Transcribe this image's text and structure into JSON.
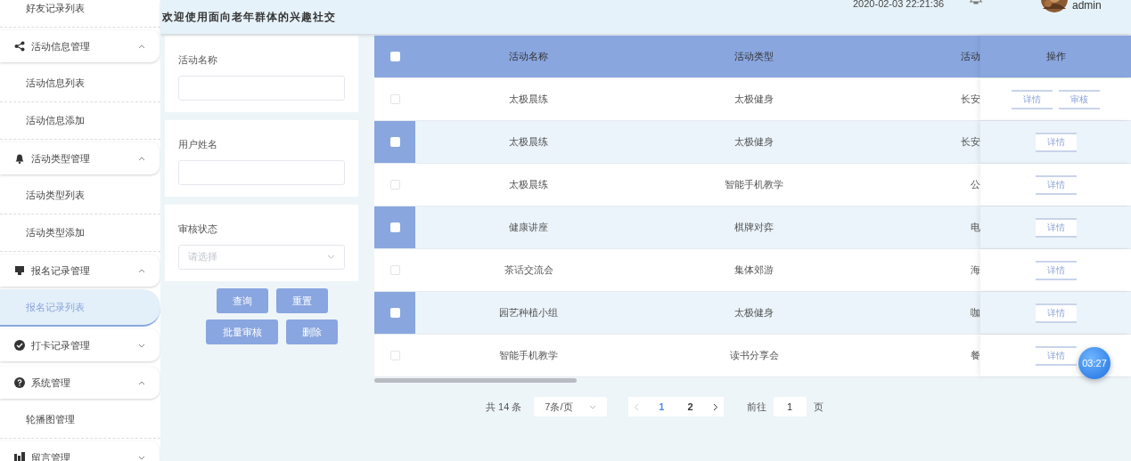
{
  "header": {
    "title": "欢迎使用面向老年群体的兴趣社交",
    "datetime": "2020-02-03 22:21:36",
    "user": "admin"
  },
  "sidebar": {
    "items": [
      {
        "kind": "sub",
        "label": "好友记录列表",
        "selected": false
      },
      {
        "kind": "group",
        "label": "活动信息管理",
        "expanded": true
      },
      {
        "kind": "sub",
        "label": "活动信息列表",
        "selected": false
      },
      {
        "kind": "sub",
        "label": "活动信息添加",
        "selected": false
      },
      {
        "kind": "group",
        "label": "活动类型管理",
        "expanded": true
      },
      {
        "kind": "sub",
        "label": "活动类型列表",
        "selected": false
      },
      {
        "kind": "sub",
        "label": "活动类型添加",
        "selected": false
      },
      {
        "kind": "group",
        "label": "报名记录管理",
        "expanded": true
      },
      {
        "kind": "sub",
        "label": "报名记录列表",
        "selected": true
      },
      {
        "kind": "group",
        "label": "打卡记录管理",
        "expanded": false
      },
      {
        "kind": "group",
        "label": "系统管理",
        "expanded": true
      },
      {
        "kind": "sub",
        "label": "轮播图管理",
        "selected": false
      },
      {
        "kind": "group",
        "label": "留言管理",
        "expanded": false
      }
    ]
  },
  "filters": [
    {
      "kind": "input",
      "label": "活动名称"
    },
    {
      "kind": "input",
      "label": "用户姓名"
    },
    {
      "kind": "select",
      "label": "审核状态",
      "placeholder": "请选择"
    }
  ],
  "buttons": [
    "查询",
    "重置",
    "批量审核",
    "删除"
  ],
  "table": {
    "columns": [
      "活动名称",
      "活动类型",
      "活动",
      "操作"
    ],
    "all_checked": false,
    "rows": [
      {
        "checked": false,
        "cells": [
          "太极晨练",
          "太极健身",
          "长安"
        ],
        "actions": [
          "详情",
          "审核"
        ]
      },
      {
        "checked": false,
        "cells": [
          "太极晨练",
          "太极健身",
          "长安"
        ],
        "actions": [
          "详情"
        ]
      },
      {
        "checked": false,
        "cells": [
          "太极晨练",
          "智能手机教学",
          "公"
        ],
        "actions": [
          "详情"
        ]
      },
      {
        "checked": false,
        "cells": [
          "健康讲座",
          "棋牌对弈",
          "电"
        ],
        "actions": [
          "详情"
        ]
      },
      {
        "checked": false,
        "cells": [
          "茶话交流会",
          "集体郊游",
          "海"
        ],
        "actions": [
          "详情"
        ]
      },
      {
        "checked": false,
        "cells": [
          "园艺种植小组",
          "太极健身",
          "咖"
        ],
        "actions": [
          "详情"
        ]
      },
      {
        "checked": false,
        "cells": [
          "智能手机教学",
          "读书分享会",
          "餐"
        ],
        "actions": [
          "详情"
        ]
      }
    ]
  },
  "pagination": {
    "total": "共 14 条",
    "page_size": "7条/页",
    "pages": [
      {
        "label": "1",
        "selected": true
      },
      {
        "label": "2",
        "selected": false
      }
    ],
    "goto_label": "前往",
    "goto_value": "1",
    "goto_suffix": "页"
  },
  "timer": "03:27"
}
